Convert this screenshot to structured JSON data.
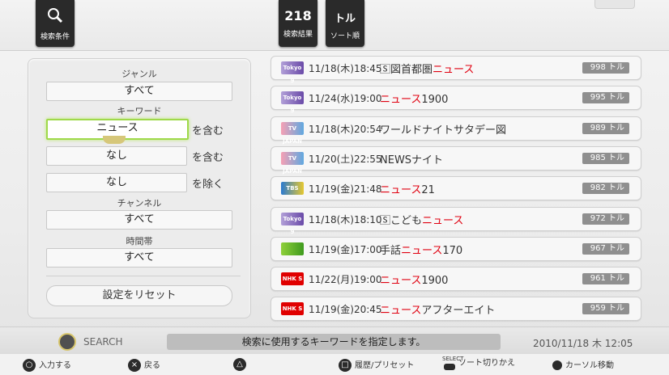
{
  "top": {
    "search_conditions_label": "検索条件",
    "result_count": "218",
    "result_label": "検索結果",
    "sort_big": "トル",
    "sort_label": "ソート順"
  },
  "left": {
    "genre_label": "ジャンル",
    "genre_value": "すべて",
    "keyword_label": "キーワード",
    "kw1_value": "ニュース",
    "kw1_suffix": "を含む",
    "kw2_value": "なし",
    "kw2_suffix": "を含む",
    "kw3_value": "なし",
    "kw3_suffix": "を除く",
    "channel_label": "チャンネル",
    "channel_value": "すべて",
    "time_label": "時間帯",
    "time_value": "すべて",
    "reset_label": "設定をリセット"
  },
  "results": [
    {
      "logo": "Tokyo 9",
      "logo_class": "tokyo",
      "datetime": "11/18(木)18:45",
      "title_pre": "🅂図首都圏",
      "title_hl": "ニュース",
      "title_post": "",
      "score": "998 トル"
    },
    {
      "logo": "Tokyo 9",
      "logo_class": "tokyo",
      "datetime": "11/24(水)19:00",
      "title_pre": "",
      "title_hl": "ニュース",
      "title_post": "1900",
      "score": "995 トル"
    },
    {
      "logo": "TV JAPAN",
      "logo_class": "tv",
      "datetime": "11/18(木)20:54",
      "title_pre": "ワールドナイトサタデー図",
      "title_hl": "",
      "title_post": "",
      "score": "989 トル"
    },
    {
      "logo": "TV JAPAN",
      "logo_class": "tv",
      "datetime": "11/20(土)22:55",
      "title_pre": "NEWSナイト",
      "title_hl": "",
      "title_post": "",
      "score": "985 トル"
    },
    {
      "logo": "TBS",
      "logo_class": "tbs",
      "datetime": "11/19(金)21:48",
      "title_pre": "",
      "title_hl": "ニュース",
      "title_post": "21",
      "score": "982 トル"
    },
    {
      "logo": "Tokyo 9",
      "logo_class": "tokyo",
      "datetime": "11/18(木)18:10",
      "title_pre": "🅂こども",
      "title_hl": "ニュース",
      "title_post": "",
      "score": "972 トル"
    },
    {
      "logo": "",
      "logo_class": "etv",
      "datetime": "11/19(金)17:00",
      "title_pre": "手話",
      "title_hl": "ニュース",
      "title_post": "170",
      "score": "967 トル"
    },
    {
      "logo": "NHK S",
      "logo_class": "nhk",
      "datetime": "11/22(月)19:00",
      "title_pre": "",
      "title_hl": "ニュース",
      "title_post": "1900",
      "score": "961 トル"
    },
    {
      "logo": "NHK S",
      "logo_class": "nhk",
      "datetime": "11/19(金)20:45",
      "title_pre": "",
      "title_hl": "ニュース",
      "title_post": "アフターエイト",
      "score": "959 トル"
    }
  ],
  "status": {
    "search_label": "SEARCH",
    "hint": "検索に使用するキーワードを指定します。",
    "clock": "2010/11/18 木 12:05"
  },
  "help": {
    "circle": "入力する",
    "cross": "戻る",
    "square": "履歴/プリセット",
    "select_caption": "SELECT",
    "select": "ソート切りかえ",
    "stick": "カーソル移動"
  }
}
